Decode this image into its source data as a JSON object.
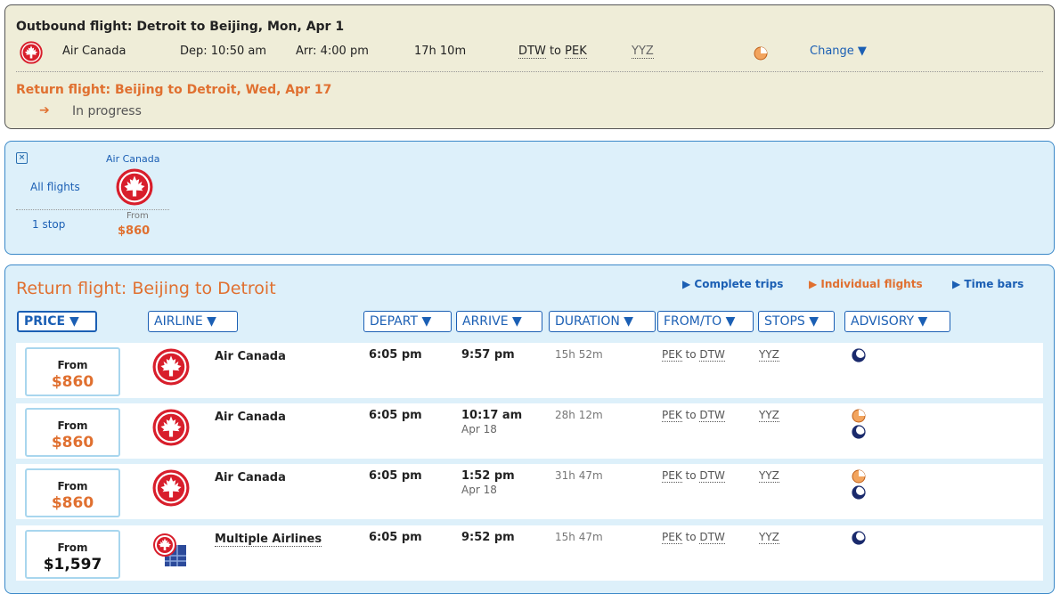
{
  "colors": {
    "accent_orange": "#e07030",
    "link_blue": "#1b5fb4",
    "panel_tan": "#efedd8",
    "panel_blue": "#ddf0fa",
    "moon_navy": "#1a2a6c"
  },
  "outbound": {
    "title": "Outbound flight: Detroit to Beijing, Mon, Apr 1",
    "airline": "Air Canada",
    "dep": "Dep: 10:50 am",
    "arr": "Arr: 4:00 pm",
    "duration": "17h 10m",
    "from": "DTW",
    "to_word": "to",
    "to": "PEK",
    "stop": "YYZ",
    "advisory_icon": "pie-icon",
    "change_label": "Change ▼"
  },
  "return_section": {
    "title": "Return flight: Beijing to Detroit, Wed, Apr 17",
    "arrow": "➔",
    "status": "In progress"
  },
  "filter": {
    "close_icon": "×",
    "all_flights": "All flights",
    "one_stop": "1 stop",
    "airline": "Air Canada",
    "from_label": "From",
    "price": "$860"
  },
  "results": {
    "title": "Return flight: Beijing to Detroit",
    "views": {
      "complete": "▶ Complete trips",
      "individual": "▶ Individual flights",
      "timebars": "▶ Time bars"
    },
    "sort": {
      "price": "PRICE ▼",
      "airline": "AIRLINE ▼",
      "depart": "DEPART ▼",
      "arrive": "ARRIVE ▼",
      "duration": "DURATION ▼",
      "fromto": "FROM/TO ▼",
      "stops": "STOPS ▼",
      "advisory": "ADVISORY ▼"
    },
    "rows": [
      {
        "from_label": "From",
        "price": "$860",
        "airline": "Air Canada",
        "depart": "6:05 pm",
        "arrive": "9:57 pm",
        "arrive_date": "",
        "duration": "15h 52m",
        "from": "PEK",
        "to_word": "to",
        "to": "DTW",
        "stop": "YYZ",
        "advisory": [
          "moon-icon"
        ]
      },
      {
        "from_label": "From",
        "price": "$860",
        "airline": "Air Canada",
        "depart": "6:05 pm",
        "arrive": "10:17 am",
        "arrive_date": "Apr 18",
        "duration": "28h 12m",
        "from": "PEK",
        "to_word": "to",
        "to": "DTW",
        "stop": "YYZ",
        "advisory": [
          "pie-icon",
          "moon-icon"
        ]
      },
      {
        "from_label": "From",
        "price": "$860",
        "airline": "Air Canada",
        "depart": "6:05 pm",
        "arrive": "1:52 pm",
        "arrive_date": "Apr 18",
        "duration": "31h 47m",
        "from": "PEK",
        "to_word": "to",
        "to": "DTW",
        "stop": "YYZ",
        "advisory": [
          "pie-icon",
          "moon-icon"
        ]
      },
      {
        "from_label": "From",
        "price": "$1,597",
        "airline": "Multiple Airlines",
        "depart": "6:05 pm",
        "arrive": "9:52 pm",
        "arrive_date": "",
        "duration": "15h 47m",
        "from": "PEK",
        "to_word": "to",
        "to": "DTW",
        "stop": "YYZ",
        "advisory": [
          "moon-icon"
        ]
      }
    ]
  }
}
